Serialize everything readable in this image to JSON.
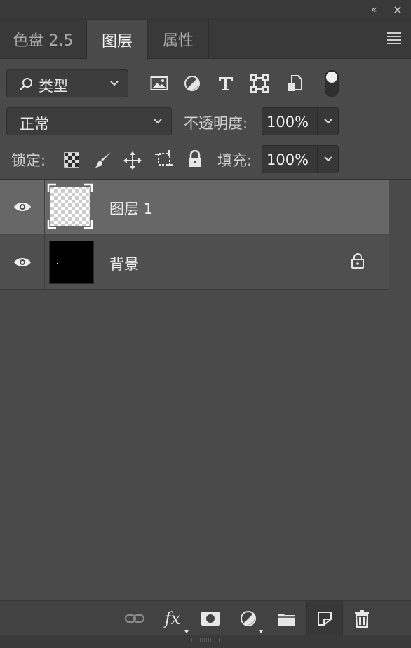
{
  "window": {
    "collapse_glyph": "‹‹",
    "close_glyph": "✕"
  },
  "tabs": [
    {
      "label": "色盘 2.5",
      "active": false
    },
    {
      "label": "图层",
      "active": true
    },
    {
      "label": "属性",
      "active": false
    }
  ],
  "filter": {
    "kind_label": "类型",
    "icons": [
      "image-filter-icon",
      "adjustment-filter-icon",
      "type-filter-icon",
      "shape-filter-icon",
      "smart-object-filter-icon"
    ]
  },
  "blend": {
    "mode": "正常",
    "opacity_label": "不透明度:",
    "opacity_value": "100%"
  },
  "lock": {
    "label": "锁定:",
    "fill_label": "填充:",
    "fill_value": "100%"
  },
  "layers": [
    {
      "name": "图层 1",
      "visible": true,
      "selected": true,
      "locked": false
    },
    {
      "name": "背景",
      "visible": true,
      "selected": false,
      "locked": true
    }
  ],
  "bottom_tools": [
    "link-layers-icon",
    "fx-icon",
    "mask-icon",
    "adjustment-icon",
    "group-folder-icon",
    "new-layer-icon",
    "delete-icon"
  ],
  "fx_label": "fx",
  "colors": {
    "panel_bg": "#4a4a4a",
    "selected_layer": "#676767",
    "tab_bar": "#393939"
  }
}
